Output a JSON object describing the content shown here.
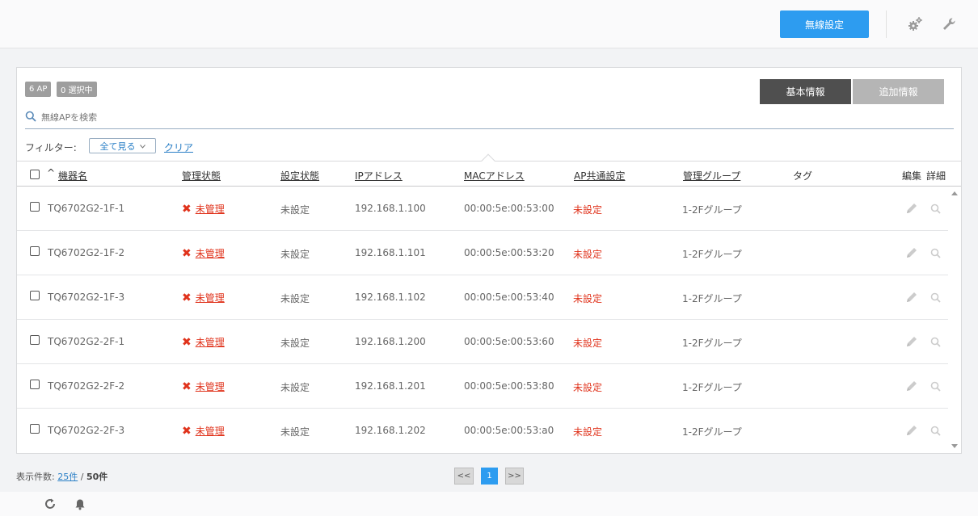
{
  "header": {
    "wireless_settings_label": "無線設定"
  },
  "panel": {
    "ap_count_badge": "6 AP",
    "selected_badge": "0 選択中",
    "tab_basic": "基本情報",
    "tab_extra": "追加情報",
    "search_placeholder": "無線APを検索",
    "filter_label": "フィルター:",
    "filter_value": "全て見る",
    "filter_clear": "クリア"
  },
  "table": {
    "columns": {
      "sort_indicator": "^",
      "device_name": "機器名",
      "mgmt_status": "管理状態",
      "config_status": "設定状態",
      "ip": "IPアドレス",
      "mac": "MACアドレス",
      "ap_common": "AP共通設定",
      "mgmt_group": "管理グループ",
      "tag": "タグ",
      "edit": "編集",
      "detail": "詳細"
    },
    "rows": [
      {
        "name": "TQ6702G2-1F-1",
        "status": "未管理",
        "config": "未設定",
        "ip": "192.168.1.100",
        "mac": "00:00:5e:00:53:00",
        "ap_common": "未設定",
        "group": "1-2Fグループ"
      },
      {
        "name": "TQ6702G2-1F-2",
        "status": "未管理",
        "config": "未設定",
        "ip": "192.168.1.101",
        "mac": "00:00:5e:00:53:20",
        "ap_common": "未設定",
        "group": "1-2Fグループ"
      },
      {
        "name": "TQ6702G2-1F-3",
        "status": "未管理",
        "config": "未設定",
        "ip": "192.168.1.102",
        "mac": "00:00:5e:00:53:40",
        "ap_common": "未設定",
        "group": "1-2Fグループ"
      },
      {
        "name": "TQ6702G2-2F-1",
        "status": "未管理",
        "config": "未設定",
        "ip": "192.168.1.200",
        "mac": "00:00:5e:00:53:60",
        "ap_common": "未設定",
        "group": "1-2Fグループ"
      },
      {
        "name": "TQ6702G2-2F-2",
        "status": "未管理",
        "config": "未設定",
        "ip": "192.168.1.201",
        "mac": "00:00:5e:00:53:80",
        "ap_common": "未設定",
        "group": "1-2Fグループ"
      },
      {
        "name": "TQ6702G2-2F-3",
        "status": "未管理",
        "config": "未設定",
        "ip": "192.168.1.202",
        "mac": "00:00:5e:00:53:a0",
        "ap_common": "未設定",
        "group": "1-2Fグループ"
      }
    ]
  },
  "footer": {
    "count_label": "表示件数:",
    "per_page": "25件",
    "separator": "/",
    "total": "50件",
    "prev": "<<",
    "current_page": "1",
    "next": ">>"
  },
  "icons": {
    "settings": "gears-icon",
    "tools": "wrench-icon",
    "search": "search-icon",
    "edit": "pencil-icon",
    "detail": "magnifier-icon",
    "refresh": "refresh-icon",
    "notifications": "bell-icon",
    "status_x": "x-mark-icon"
  },
  "colors": {
    "primary": "#2d9cf0",
    "danger": "#e0331c",
    "tab_active": "#4f4f4f",
    "tab_inactive": "#b5b5b5",
    "link": "#2a7fc6"
  }
}
